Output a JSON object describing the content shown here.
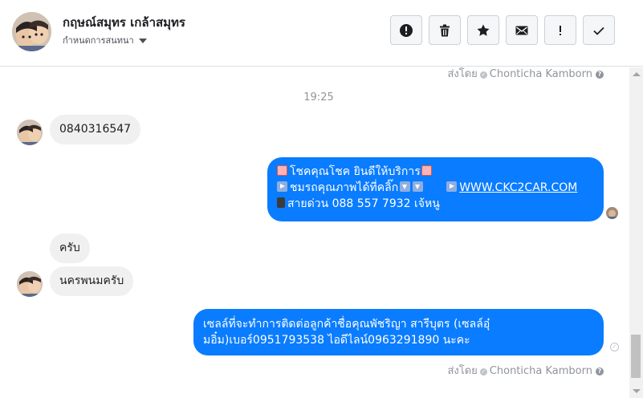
{
  "header": {
    "contact_name": "กฤษณ์สมุทร เกล้าสมุทร",
    "subtitle": "กำหนดการสนทนา",
    "toolbar": [
      {
        "name": "report-spam-button",
        "icon": "exclamation-circle-icon"
      },
      {
        "name": "delete-button",
        "icon": "trash-icon"
      },
      {
        "name": "star-button",
        "icon": "star-icon"
      },
      {
        "name": "mark-unread-button",
        "icon": "envelope-icon"
      },
      {
        "name": "follow-up-button",
        "icon": "exclamation-icon"
      },
      {
        "name": "mark-done-button",
        "icon": "check-icon"
      }
    ]
  },
  "conversation": {
    "top_sent_by": {
      "prefix": "ส่งโดย",
      "sender": "Chonticha Kamborn"
    },
    "timestamp": "19:25",
    "messages": [
      {
        "direction": "in",
        "text": "0840316547"
      },
      {
        "direction": "out",
        "line1": "โชคคุณโชค ยินดีให้บริการ",
        "line2_text": "ชมรถคุณภาพได้ที่คลิ๊ก",
        "line2_link": "WWW.CKC2CAR.COM",
        "line3": "สายด่วน 088 557 7932 เจ้หนู"
      },
      {
        "direction": "in",
        "text": "ครับ"
      },
      {
        "direction": "in",
        "text": "นครพนมครับ"
      },
      {
        "direction": "out",
        "line1": "เซลล์ที่จะทำการติดต่อลูกค้าชื่อคุณพัชริญา สารีบุตร (เซลล์อุ๋",
        "line2": "มอิ๋ม)เบอร์0951793538 ไอดีไลน์0963291890 นะคะ"
      }
    ],
    "bottom_sent_by": {
      "prefix": "ส่งโดย",
      "sender": "Chonticha Kamborn"
    }
  },
  "colors": {
    "outgoing_bubble": "#0a7cff",
    "incoming_bubble": "#f1f0f0",
    "meta_text": "#90949c"
  }
}
